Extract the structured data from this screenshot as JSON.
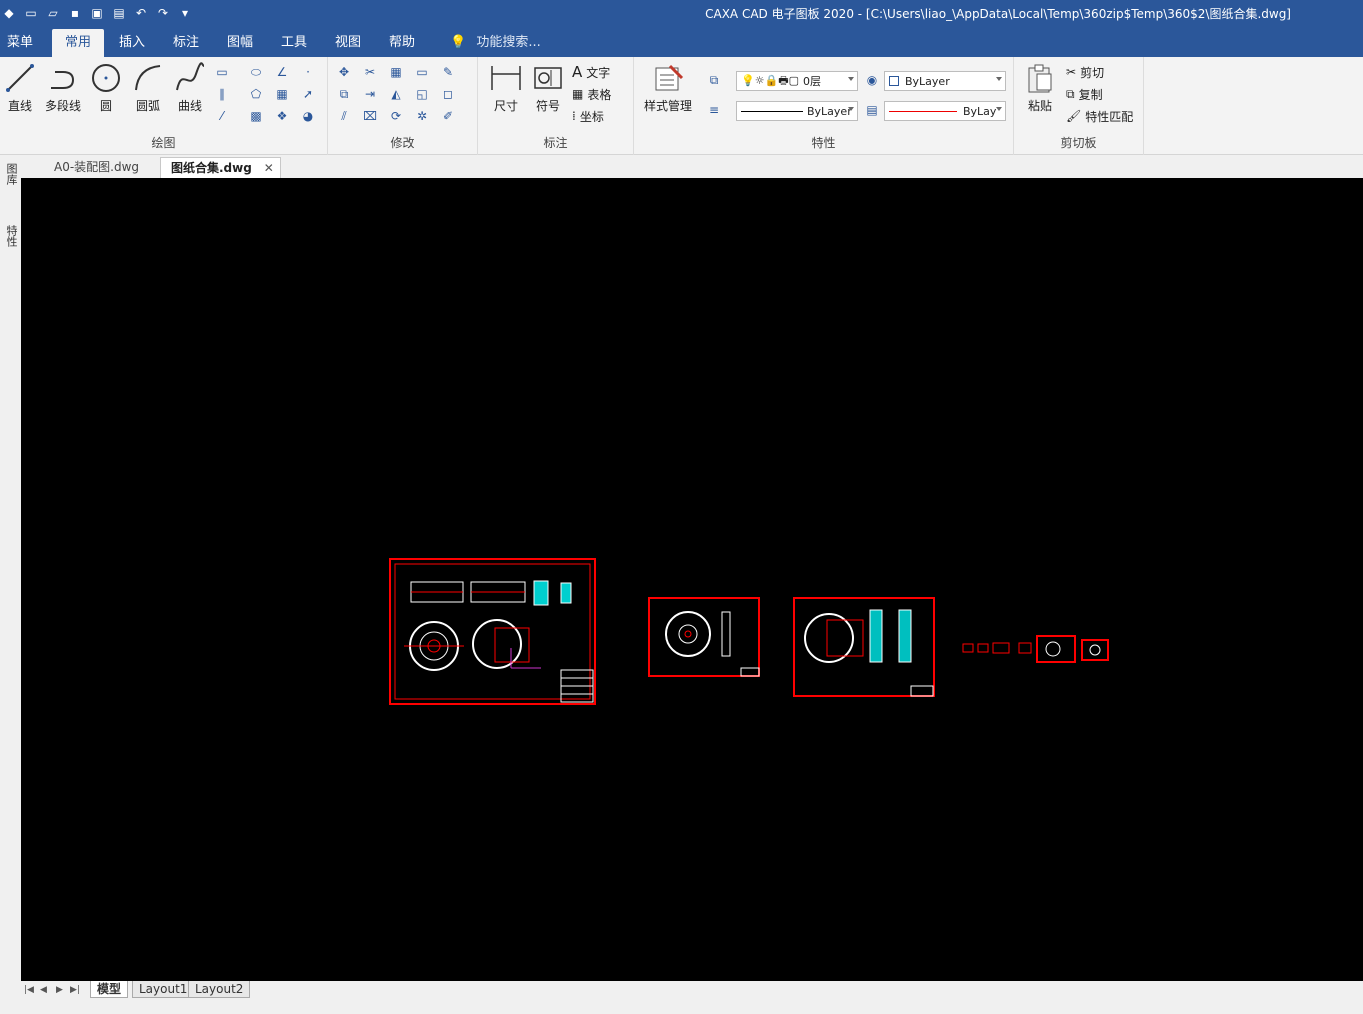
{
  "titlebar": {
    "title": "CAXA CAD 电子图板 2020 - [C:\\Users\\liao_\\AppData\\Local\\Temp\\360zip$Temp\\360$2\\图纸合集.dwg]",
    "quick_access": [
      "new-icon",
      "open-icon",
      "save-icon",
      "save-as-icon",
      "print-icon",
      "undo-icon",
      "redo-icon",
      "customize-icon"
    ]
  },
  "menu": {
    "tabs": [
      {
        "id": "menu",
        "label": "菜单"
      },
      {
        "id": "common",
        "label": "常用",
        "active": true
      },
      {
        "id": "insert",
        "label": "插入"
      },
      {
        "id": "annotate",
        "label": "标注"
      },
      {
        "id": "sheet",
        "label": "图幅"
      },
      {
        "id": "tools",
        "label": "工具"
      },
      {
        "id": "view",
        "label": "视图"
      },
      {
        "id": "help",
        "label": "帮助"
      }
    ],
    "search_placeholder": "功能搜索..."
  },
  "ribbon": {
    "draw": {
      "label": "绘图",
      "big": [
        {
          "id": "line",
          "label": "直线"
        },
        {
          "id": "polyline",
          "label": "多段线"
        },
        {
          "id": "circle",
          "label": "圆"
        },
        {
          "id": "arc",
          "label": "圆弧"
        },
        {
          "id": "curve",
          "label": "曲线"
        }
      ]
    },
    "modify": {
      "label": "修改"
    },
    "annotation": {
      "label": "标注",
      "big": [
        {
          "id": "dimension",
          "label": "尺寸"
        },
        {
          "id": "symbol",
          "label": "符号"
        }
      ],
      "small": [
        {
          "id": "text",
          "label": "文字"
        },
        {
          "id": "table",
          "label": "表格"
        },
        {
          "id": "coordinate",
          "label": "坐标"
        }
      ]
    },
    "properties": {
      "label": "特性",
      "style_manager": "样式管理",
      "layer": "0层",
      "color": "ByLayer",
      "linetype": "ByLayer",
      "lineweight": "ByLay"
    },
    "clipboard": {
      "label": "剪切板",
      "paste": "粘贴",
      "cut": "剪切",
      "copy": "复制",
      "match": "特性匹配"
    }
  },
  "doc_tabs": [
    {
      "label": "A0-装配图.dwg",
      "active": false
    },
    {
      "label": "图纸合集.dwg",
      "active": true
    }
  ],
  "left_panel": [
    "图库",
    "特性"
  ],
  "layout_tabs": [
    {
      "label": "模型",
      "active": true
    },
    {
      "label": "Layout1",
      "active": false
    },
    {
      "label": "Layout2",
      "active": false
    }
  ],
  "colors": {
    "brand": "#2b579a",
    "canvas": "#000000",
    "frame": "#ff0000",
    "geometry": "#ffffff",
    "accent": "#00ffff"
  }
}
